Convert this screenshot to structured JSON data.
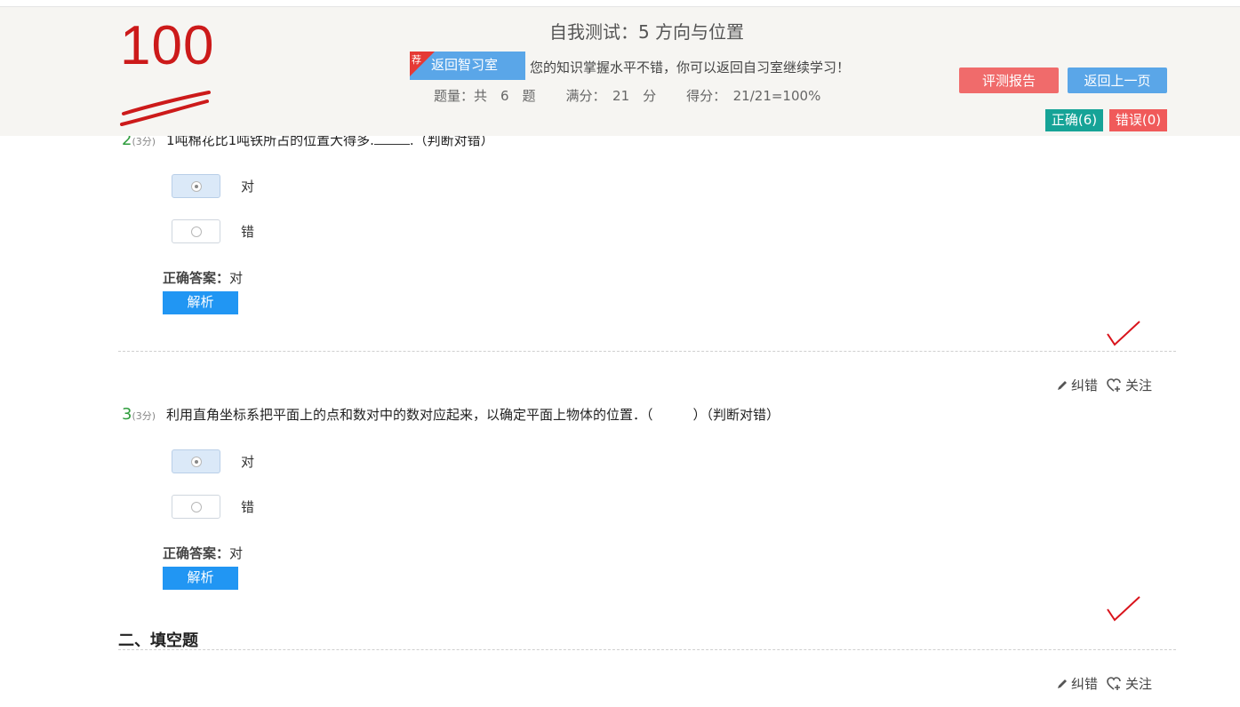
{
  "header": {
    "score": "100",
    "title": "自我测试：5 方向与位置",
    "recommend_tag": "荐",
    "back_room_label": "返回智习室",
    "notice": "您的知识掌握水平不错，你可以返回自习室继续学习！",
    "stats": {
      "count": "题量：共　6　题",
      "full": "满分：　21　分",
      "got": "得分：　21/21=100%"
    },
    "report_button": "评测报告",
    "back_button": "返回上一页",
    "correct_badge": "正确(6)",
    "wrong_badge": "错误(0)"
  },
  "questions": [
    {
      "num": "2",
      "points": "(3分)",
      "text_before": "1吨棉花比1吨铁所占的位置大得多.",
      "text_after": ".（判断对错）",
      "options": [
        {
          "label": "对",
          "selected": true
        },
        {
          "label": "错",
          "selected": false
        }
      ],
      "answer_label": "正确答案：",
      "answer_value": "对",
      "analysis_button": "解析"
    },
    {
      "num": "3",
      "points": "(3分)",
      "text": "利用直角坐标系把平面上的点和数对中的数对应起来，以确定平面上物体的位置．（　　　）（判断对错）",
      "options": [
        {
          "label": "对",
          "selected": true
        },
        {
          "label": "错",
          "selected": false
        }
      ],
      "answer_label": "正确答案：",
      "answer_value": "对",
      "analysis_button": "解析"
    }
  ],
  "tools": {
    "correct_label": "纠错",
    "follow_label": "关注"
  },
  "section2_title": "二、填空题",
  "colors": {
    "score_red": "#cc1a1a",
    "accent_blue": "#2196f3",
    "correct_green": "#16a397",
    "wrong_red": "#f05a5a",
    "check_red": "#d9141c"
  }
}
